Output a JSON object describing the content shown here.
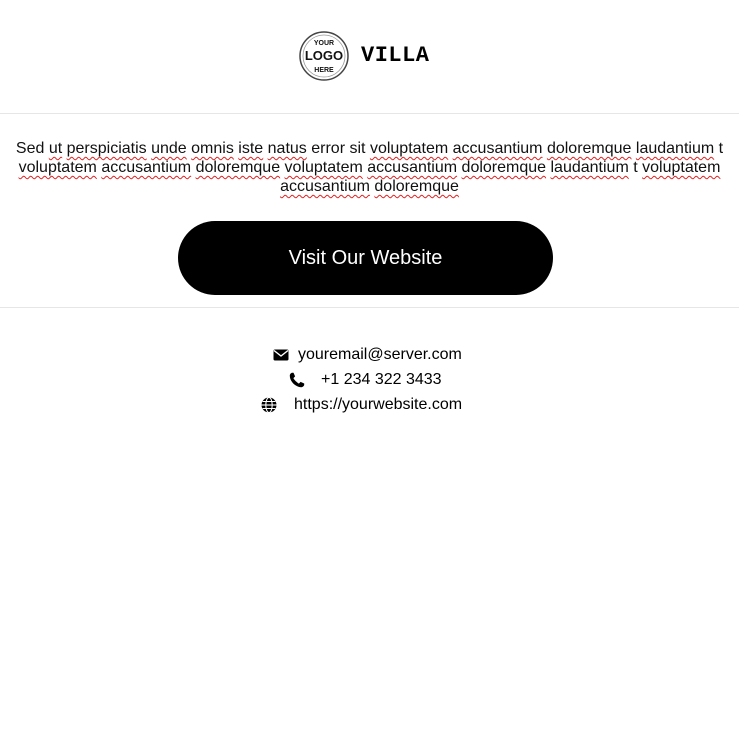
{
  "header": {
    "logo_text": [
      "YOUR",
      "LOGO",
      "HERE"
    ],
    "brand_name": "VILLA"
  },
  "body": {
    "paragraph_words": [
      {
        "t": "Sed",
        "sp": false
      },
      {
        "t": "ut",
        "sp": true
      },
      {
        "t": "perspiciatis",
        "sp": true
      },
      {
        "t": "unde",
        "sp": true
      },
      {
        "t": "omnis",
        "sp": true
      },
      {
        "t": "iste",
        "sp": true
      },
      {
        "t": "natus",
        "sp": true
      },
      {
        "t": "error",
        "sp": false
      },
      {
        "t": "sit",
        "sp": false
      },
      {
        "t": "voluptatem",
        "sp": true
      },
      {
        "t": "accusantium",
        "sp": true
      },
      {
        "t": "doloremque",
        "sp": true
      },
      {
        "t": "laudantium",
        "sp": true
      },
      {
        "t": "t",
        "sp": false
      },
      {
        "t": "voluptatem",
        "sp": true
      },
      {
        "t": "accusantium",
        "sp": true
      },
      {
        "t": "doloremque",
        "sp": true
      },
      {
        "t": "voluptatem",
        "sp": true
      },
      {
        "t": "accusantium",
        "sp": true
      },
      {
        "t": "doloremque",
        "sp": true
      },
      {
        "t": "laudantium",
        "sp": true
      },
      {
        "t": "t",
        "sp": false
      },
      {
        "t": "voluptatem",
        "sp": true
      },
      {
        "t": "accusantium",
        "sp": true
      },
      {
        "t": "doloremque",
        "sp": true
      }
    ],
    "cta_label": "Visit Our Website"
  },
  "contact": {
    "email": "youremail@server.com",
    "phone": "+1 234 322 3433",
    "website": "https://yourwebsite.com"
  },
  "icons": {
    "email": "envelope-icon",
    "phone": "phone-icon",
    "website": "globe-icon"
  },
  "colors": {
    "button_bg": "#000000",
    "button_text": "#ffffff",
    "divider": "#e6e6e6",
    "spellcheck_underline": "#e02020"
  }
}
